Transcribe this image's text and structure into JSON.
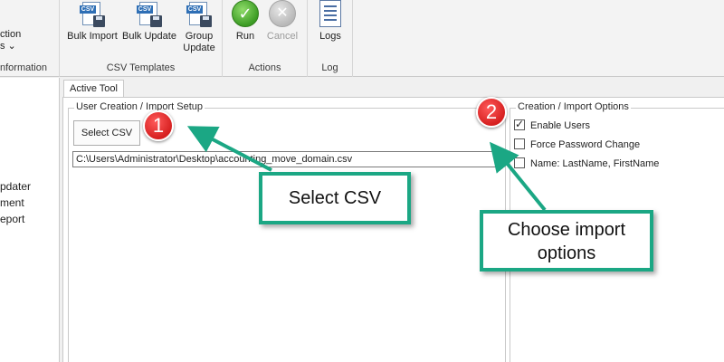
{
  "ribbon": {
    "information_group": {
      "label": "nformation",
      "item_line1": "ction",
      "item_line2": "s ⌄"
    },
    "csv_templates": {
      "label": "CSV Templates",
      "bulk_import": "Bulk Import",
      "bulk_update": "Bulk Update",
      "group_update_line1": "Group",
      "group_update_line2": "Update",
      "icon_tag": "CSV"
    },
    "actions": {
      "label": "Actions",
      "run": "Run",
      "cancel": "Cancel"
    },
    "log": {
      "label": "Log",
      "logs": "Logs"
    }
  },
  "nav": {
    "items": [
      "pdater",
      "ment",
      "eport"
    ]
  },
  "main": {
    "tab": "Active Tool",
    "setup": {
      "legend": "User Creation / Import Setup",
      "select_csv": "Select CSV",
      "file_path": "C:\\Users\\Administrator\\Desktop\\accounting_move_domain.csv"
    },
    "options": {
      "legend": "Creation / Import Options",
      "items": [
        {
          "label": "Enable Users",
          "checked": true
        },
        {
          "label": "Force Password Change",
          "checked": false
        },
        {
          "label": "Name: LastName, FirstName",
          "checked": false
        }
      ]
    }
  },
  "callouts": {
    "one": {
      "number": "1",
      "text": "Select CSV"
    },
    "two": {
      "number": "2",
      "text_line1": "Choose import",
      "text_line2": "options"
    }
  },
  "colors": {
    "callout_border": "#1ba784",
    "badge": "#d62020",
    "run_icon": "#3c9c24"
  }
}
